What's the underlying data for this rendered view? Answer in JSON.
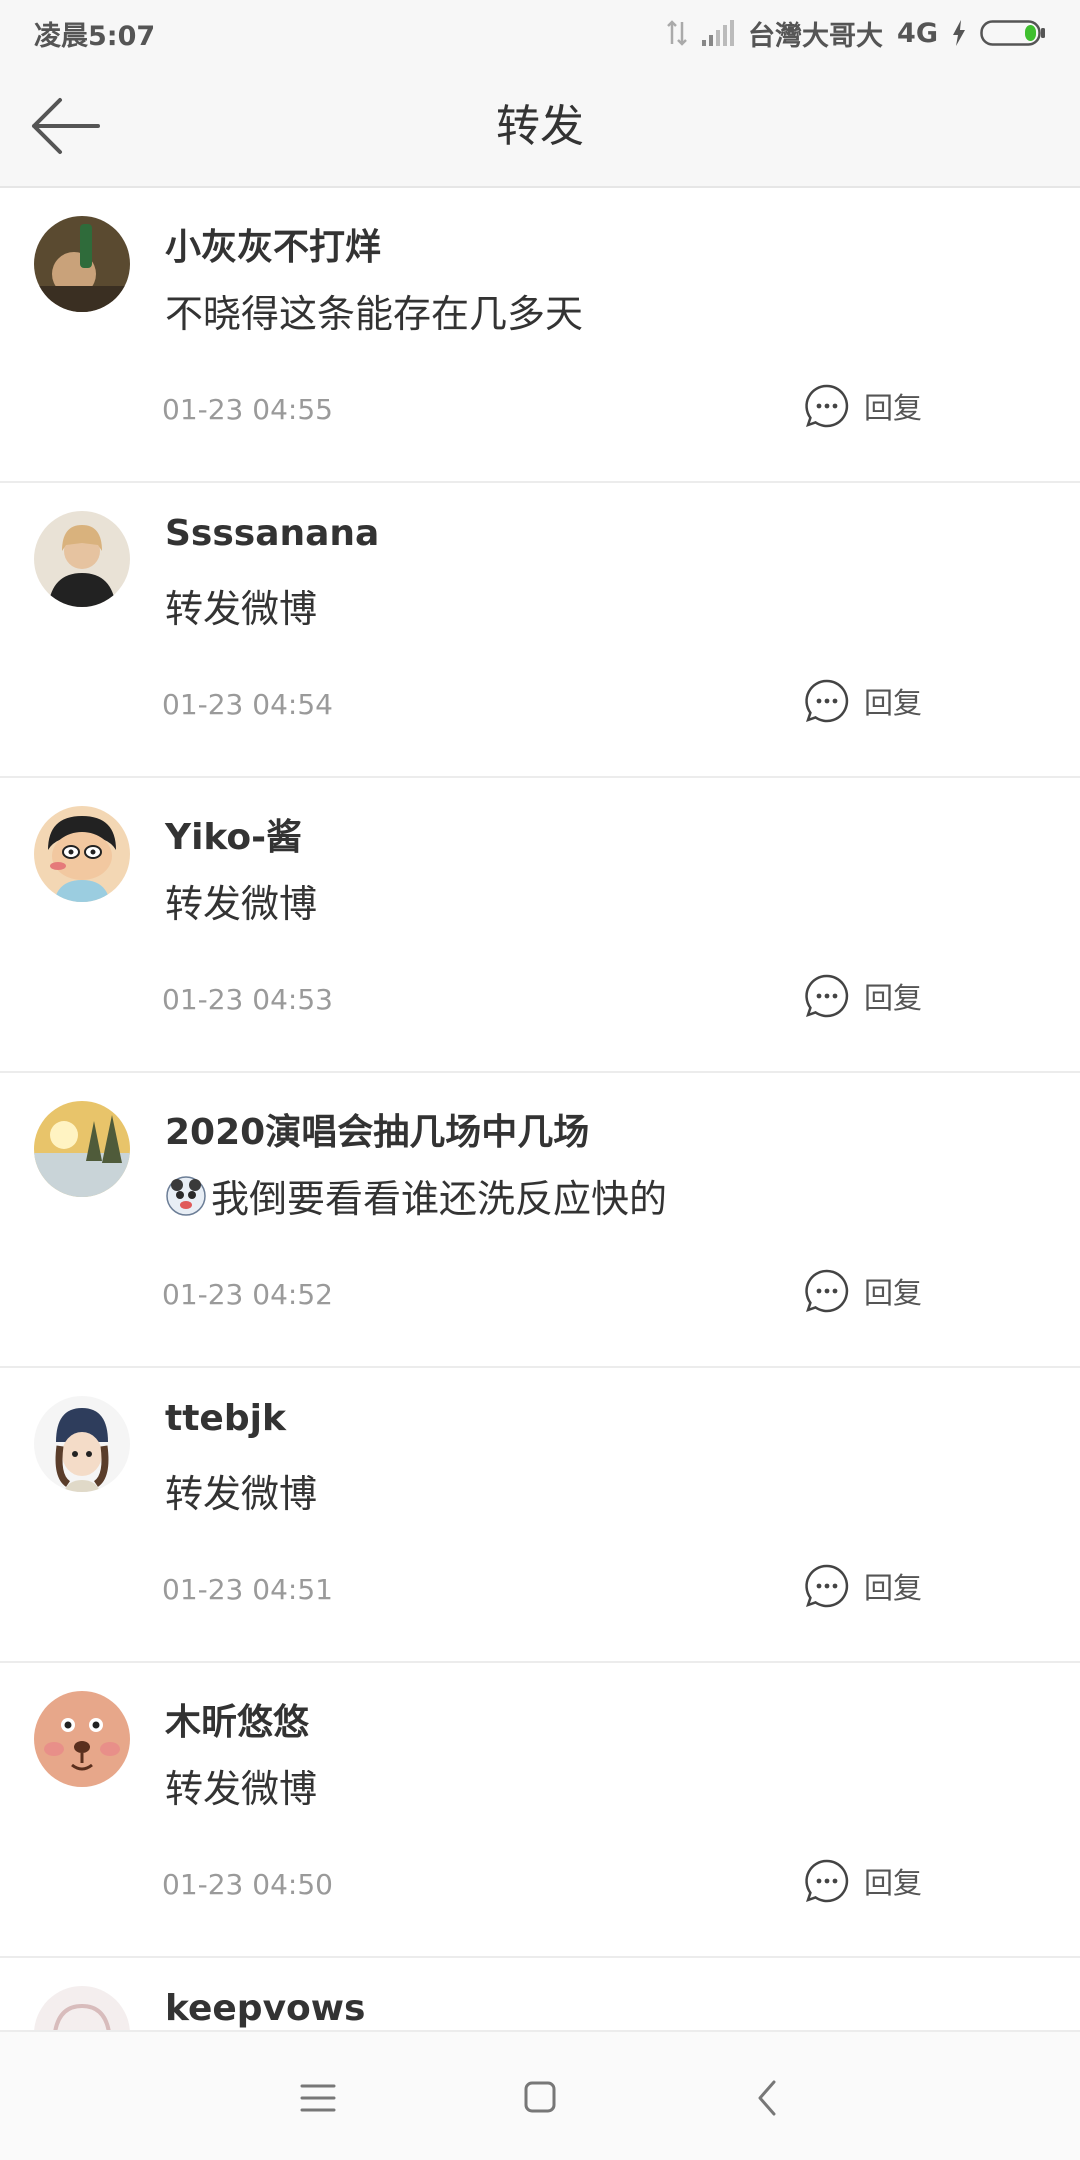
{
  "status_bar": {
    "time": "凌晨5:07",
    "carrier": "台灣大哥大",
    "network": "4G",
    "icons": [
      "data-transfer-icon",
      "signal-icon",
      "charging-bolt-icon",
      "battery-icon"
    ]
  },
  "header": {
    "title": "转发",
    "back_icon": "back-arrow-icon"
  },
  "reposts": [
    {
      "username": "小灰灰不打烊",
      "content": "不晓得这条能存在几多天",
      "timestamp": "01-23 04:55",
      "reply_label": "回复"
    },
    {
      "username": "Ssssanana",
      "content": "转发微博",
      "timestamp": "01-23 04:54",
      "reply_label": "回复"
    },
    {
      "username": "Yiko-酱",
      "content": "转发微博",
      "timestamp": "01-23 04:53",
      "reply_label": "回复"
    },
    {
      "username": "2020演唱会抽几场中几场",
      "content": "我倒要看看谁还洗反应快的",
      "timestamp": "01-23 04:52",
      "reply_label": "回复",
      "emoji": "sticker-emoji-icon"
    },
    {
      "username": "ttebjk",
      "content": "转发微博",
      "timestamp": "01-23 04:51",
      "reply_label": "回复"
    },
    {
      "username": "木昕悠悠",
      "content": "转发微博",
      "timestamp": "01-23 04:50",
      "reply_label": "回复"
    },
    {
      "username": "keepvows",
      "content": "",
      "timestamp": "",
      "reply_label": ""
    }
  ],
  "nav_bar": {
    "icons": [
      "menu-icon",
      "home-square-icon",
      "back-chevron-icon"
    ]
  },
  "colors": {
    "bar_background": "#f7f7f7",
    "text_primary": "#333333",
    "text_secondary": "#9a9a9a",
    "battery_green": "#3fbf2f"
  }
}
